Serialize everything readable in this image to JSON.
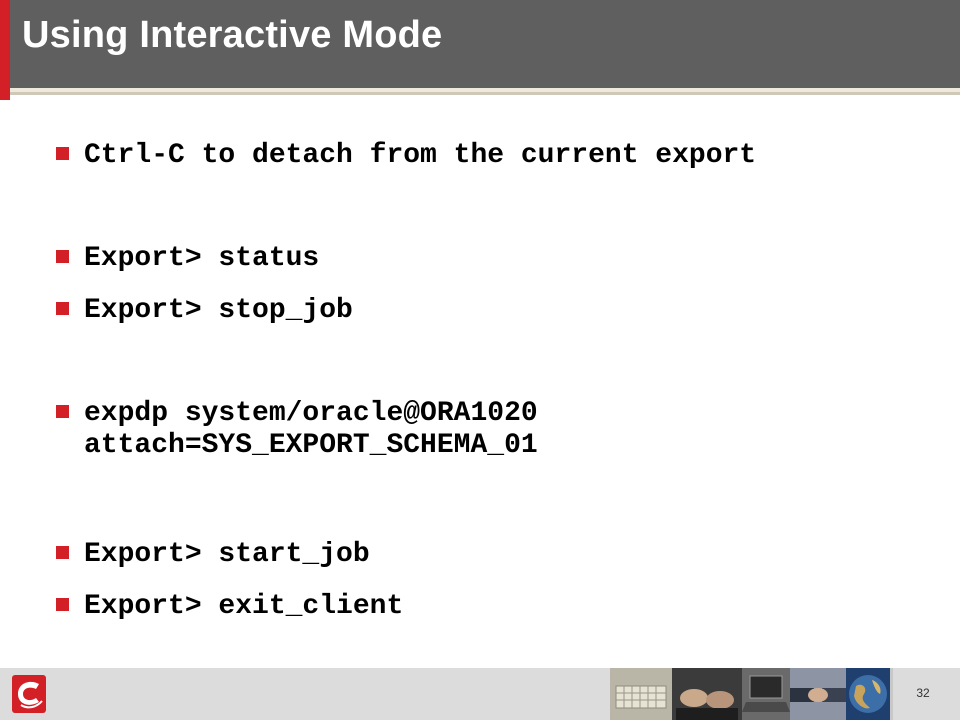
{
  "slide": {
    "title": "Using Interactive Mode",
    "page_number": "32"
  },
  "bullets": [
    {
      "lines": [
        "Ctrl-C to detach from the current export"
      ]
    },
    {
      "lines": [
        "Export> status"
      ]
    },
    {
      "lines": [
        "Export> stop_job"
      ]
    },
    {
      "lines": [
        "expdp system/oracle@ORA1020",
        "attach=SYS_EXPORT_SCHEMA_01"
      ]
    },
    {
      "lines": [
        "Export> start_job"
      ]
    },
    {
      "lines": [
        "Export> exit_client"
      ]
    }
  ],
  "colors": {
    "title_bar": "#5f5f5f",
    "accent": "#d32027",
    "bullet_marker": "#d32027",
    "footer": "#dcdcdc"
  },
  "footer": {
    "logo_icon": "company-logo-icon",
    "photo_strip_icons": [
      "keyboard-photo-icon",
      "hands-typing-photo-icon",
      "laptop-photo-icon",
      "handshake-photo-icon",
      "globe-photo-icon"
    ]
  }
}
